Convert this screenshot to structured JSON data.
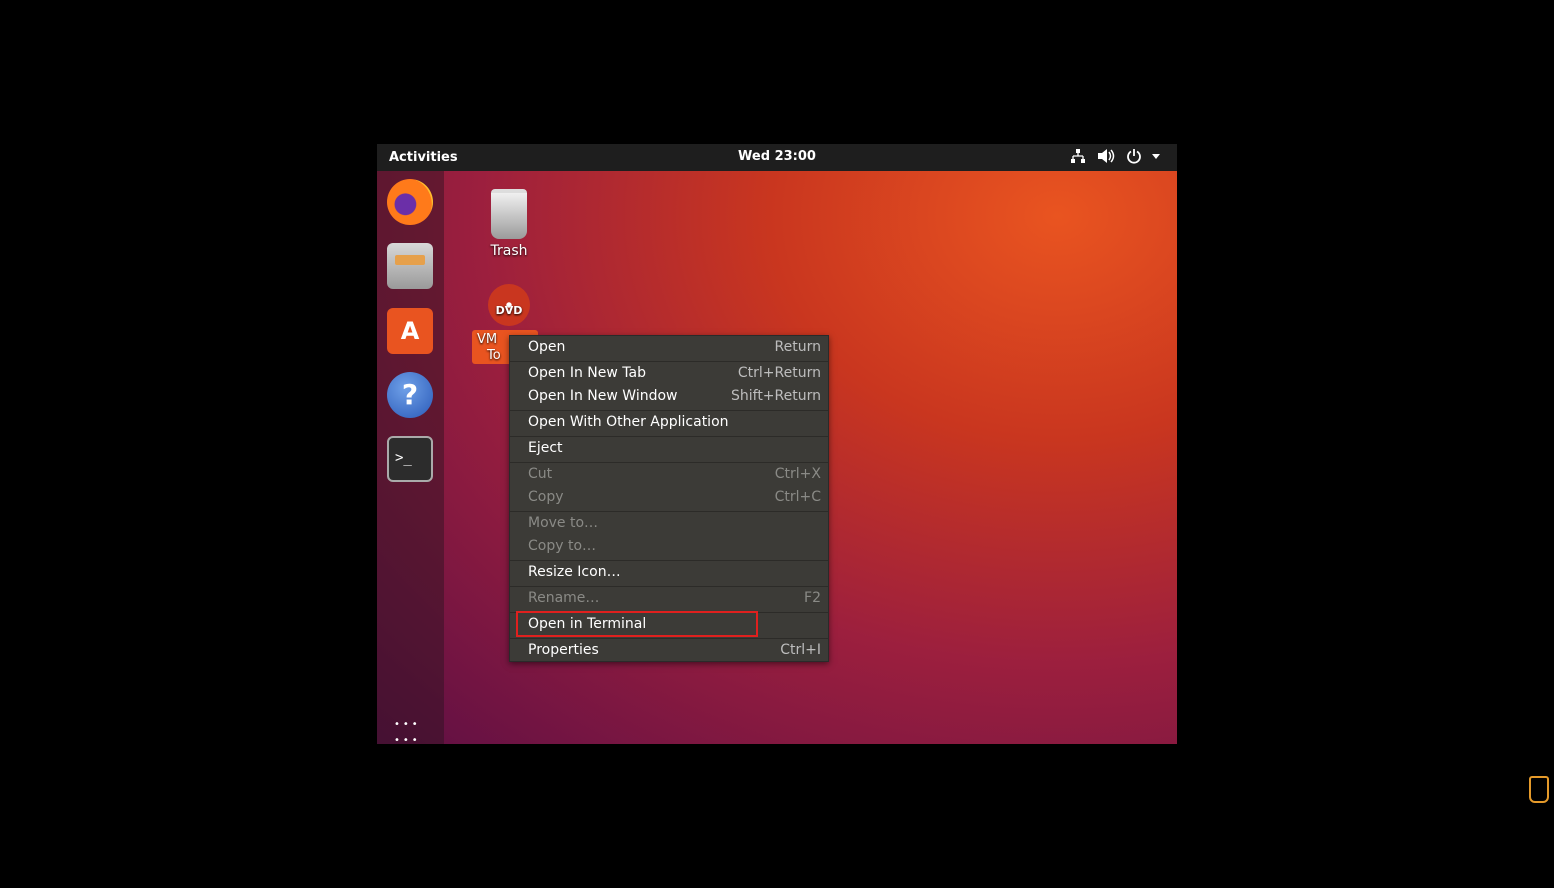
{
  "topbar": {
    "activities": "Activities",
    "clock": "Wed 23:00"
  },
  "tray_icons": [
    "network-icon",
    "volume-icon",
    "power-icon",
    "chevron-down-icon"
  ],
  "dock": {
    "items": [
      "firefox-icon",
      "files-icon",
      "software-icon",
      "help-icon",
      "terminal-icon"
    ],
    "software_glyph": "A",
    "help_glyph": "?",
    "terminal_glyph": ">_",
    "app_grid_glyph": "•••"
  },
  "desktop": {
    "trash_label": "Trash",
    "dvd_badge": "DVD",
    "dvd_label_line1": "VM",
    "dvd_label_line2": "To"
  },
  "context_menu": {
    "items": [
      {
        "label": "Open",
        "accel": "Return",
        "enabled": true
      },
      {
        "label": "Open In New Tab",
        "accel": "Ctrl+Return",
        "enabled": true
      },
      {
        "label": "Open In New Window",
        "accel": "Shift+Return",
        "enabled": true
      },
      {
        "label": "Open With Other Application",
        "accel": "",
        "enabled": true
      },
      {
        "label": "Eject",
        "accel": "",
        "enabled": true
      },
      {
        "label": "Cut",
        "accel": "Ctrl+X",
        "enabled": false
      },
      {
        "label": "Copy",
        "accel": "Ctrl+C",
        "enabled": false
      },
      {
        "label": "Move to…",
        "accel": "",
        "enabled": false
      },
      {
        "label": "Copy to…",
        "accel": "",
        "enabled": false
      },
      {
        "label": "Resize Icon…",
        "accel": "",
        "enabled": true
      },
      {
        "label": "Rename…",
        "accel": "F2",
        "enabled": false
      },
      {
        "label": "Open in Terminal",
        "accel": "",
        "enabled": true,
        "highlighted": true
      },
      {
        "label": "Properties",
        "accel": "Ctrl+I",
        "enabled": true
      }
    ]
  },
  "colors": {
    "accent": "#e95420",
    "highlight_border": "#e0201e",
    "menu_bg": "#3c3b37"
  }
}
